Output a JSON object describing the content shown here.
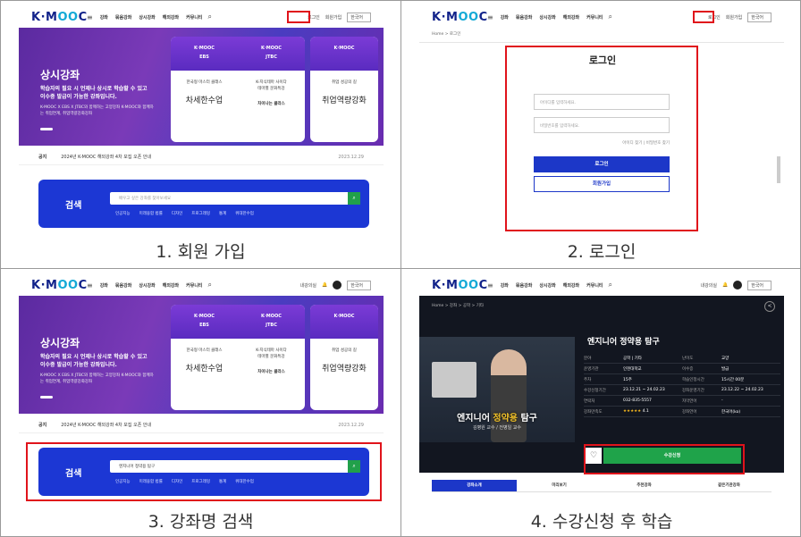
{
  "common": {
    "logo_left": "K·M",
    "logo_oo": "OO",
    "logo_right": "C",
    "nav": [
      "강좌",
      "묶음강좌",
      "상시강좌",
      "해외강좌",
      "커뮤니티"
    ],
    "lang": "한국어",
    "login": "로그인",
    "signup": "회원가입",
    "my_learning": "내강의실"
  },
  "hero": {
    "title": "상시강좌",
    "desc": "학습자의 필요 시 언제나 상시로 학습할 수 있고 이수증 발급이 가능한 강좌입니다.",
    "sub": "K-MOOC X EBS X JTBC와 함께하는 고양강좌 K-MOOC와 함께하는 취업연계, 취업역량강화강좌",
    "card_left_head": [
      "K·MOOC",
      "EBS"
    ],
    "card_right_head": [
      "K·MOOC",
      "JTBC"
    ],
    "card3_head": "K·MOOC",
    "card_items": [
      "한국형 마스터 클래스",
      "K-지식테마 사이다",
      "테마별 문화특강",
      "취업 성공의 길"
    ],
    "brush1": "차세한수업",
    "brush2": "차이나는 클라스",
    "brush3": "취업역량강화"
  },
  "notice": {
    "label": "공지",
    "text": "2024년 K-MOOC 해외강좌 4차 모집 오픈 안내",
    "date": "2023.12.29"
  },
  "search": {
    "label": "검색",
    "placeholder": "배우고 싶은 강좌를 찾아보세요",
    "typed": "엔지니어 정약용 탐구",
    "tags": [
      "인공지능",
      "미래융합 법률",
      "디자인",
      "프로그래밍",
      "통계",
      "위대한수업"
    ]
  },
  "login_page": {
    "breadcrumb": "Home  >  로그인",
    "title": "로그인",
    "id_placeholder": "아이디를 입력하세요.",
    "pw_placeholder": "비밀번호를 입력하세요.",
    "find_links": "아이디 찾기 | 비밀번호 찾기",
    "login_button": "로그인",
    "join_button": "회원가입"
  },
  "course_page": {
    "breadcrumb": "Home  >  강좌  >  공학  >  기타",
    "title": "엔지니어 정약용 탐구",
    "video_title_a": "엔지니어 ",
    "video_title_hl": "정약용",
    "video_title_b": " 탐구",
    "video_sub": "김병원 교수 / 전병일 교수",
    "rows": [
      {
        "k1": "분야",
        "v1": "공학 | 기타",
        "k2": "난이도",
        "v2": "교양"
      },
      {
        "k1": "운영기관",
        "v1": "인천대학교",
        "k2": "이수증",
        "v2": "발급"
      },
      {
        "k1": "주차",
        "v1": "15주",
        "k2": "학습인정시간",
        "v2": "15시간 00분"
      },
      {
        "k1": "수강신청기간",
        "v1": "23.12.21 ~ 24.02.23",
        "k2": "강좌운영기간",
        "v2": "23.12.22 ~ 24.02.23"
      },
      {
        "k1": "연락처",
        "v1": "032-835-5557",
        "k2": "자막언어",
        "v2": "-"
      },
      {
        "k1": "강좌만족도",
        "v1": "4.1",
        "k2": "강좌언어",
        "v2": "한국어(ko)"
      }
    ],
    "stars": "★★★★★",
    "enroll": "수강신청",
    "tabs": [
      "강좌소개",
      "미리보기",
      "추천강좌",
      "같은기관강좌"
    ]
  },
  "captions": [
    "1. 회원 가입",
    "2. 로그인",
    "3. 강좌명 검색",
    "4. 수강신청 후 학습"
  ]
}
